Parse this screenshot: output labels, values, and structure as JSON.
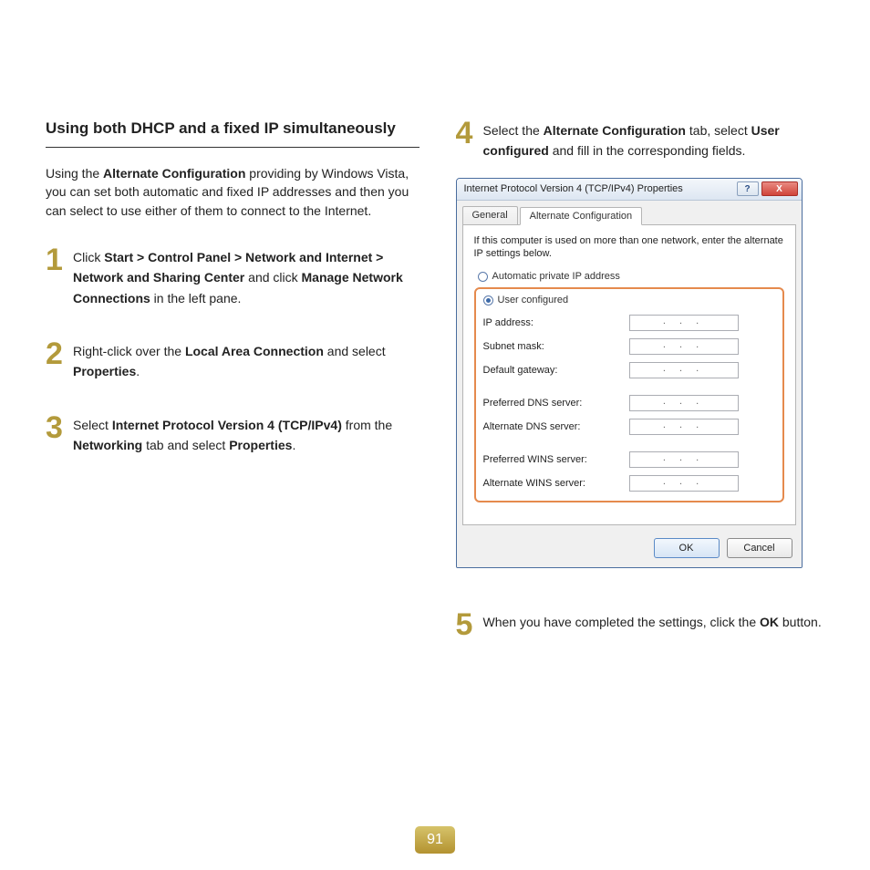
{
  "heading": "Using both DHCP and a fixed IP simultaneously",
  "intro_prefix": "Using the ",
  "intro_bold": "Alternate Configuration",
  "intro_suffix": " providing by Windows Vista, you can set both automatic and fixed IP addresses and then you can select to use either of them to connect to the Internet.",
  "steps": {
    "s1": {
      "num": "1",
      "t1": "Click ",
      "b1": "Start > Control Panel > Network and Internet > Network and Sharing Center",
      "t2": " and click ",
      "b2": "Manage Network Connections",
      "t3": " in the left pane."
    },
    "s2": {
      "num": "2",
      "t1": "Right-click over the ",
      "b1": "Local Area Connection",
      "t2": " and select ",
      "b2": "Properties",
      "t3": "."
    },
    "s3": {
      "num": "3",
      "t1": "Select ",
      "b1": "Internet Protocol Version 4 (TCP/IPv4)",
      "t2": " from the ",
      "b2": "Networking",
      "t3": " tab and select ",
      "b3": "Properties",
      "t4": "."
    },
    "s4": {
      "num": "4",
      "t1": "Select the ",
      "b1": "Alternate Configuration",
      "t2": " tab, select ",
      "b2": "User configured",
      "t3": " and fill in the corresponding fields."
    },
    "s5": {
      "num": "5",
      "t1": "When you have completed the settings, click the ",
      "b1": "OK",
      "t2": " button."
    }
  },
  "dialog": {
    "title": "Internet Protocol Version 4 (TCP/IPv4) Properties",
    "help": "?",
    "close": "X",
    "tabs": {
      "general": "General",
      "alt": "Alternate Configuration"
    },
    "description": "If this computer is used on more than one network, enter the alternate IP settings below.",
    "radio_auto": "Automatic private IP address",
    "radio_user": "User configured",
    "fields": {
      "ip": "IP address:",
      "subnet": "Subnet mask:",
      "gateway": "Default gateway:",
      "pdns": "Preferred DNS server:",
      "adns": "Alternate DNS server:",
      "pwins": "Preferred WINS server:",
      "awins": "Alternate WINS server:"
    },
    "dots": ".   .   .",
    "ok": "OK",
    "cancel": "Cancel"
  },
  "page_number": "91"
}
